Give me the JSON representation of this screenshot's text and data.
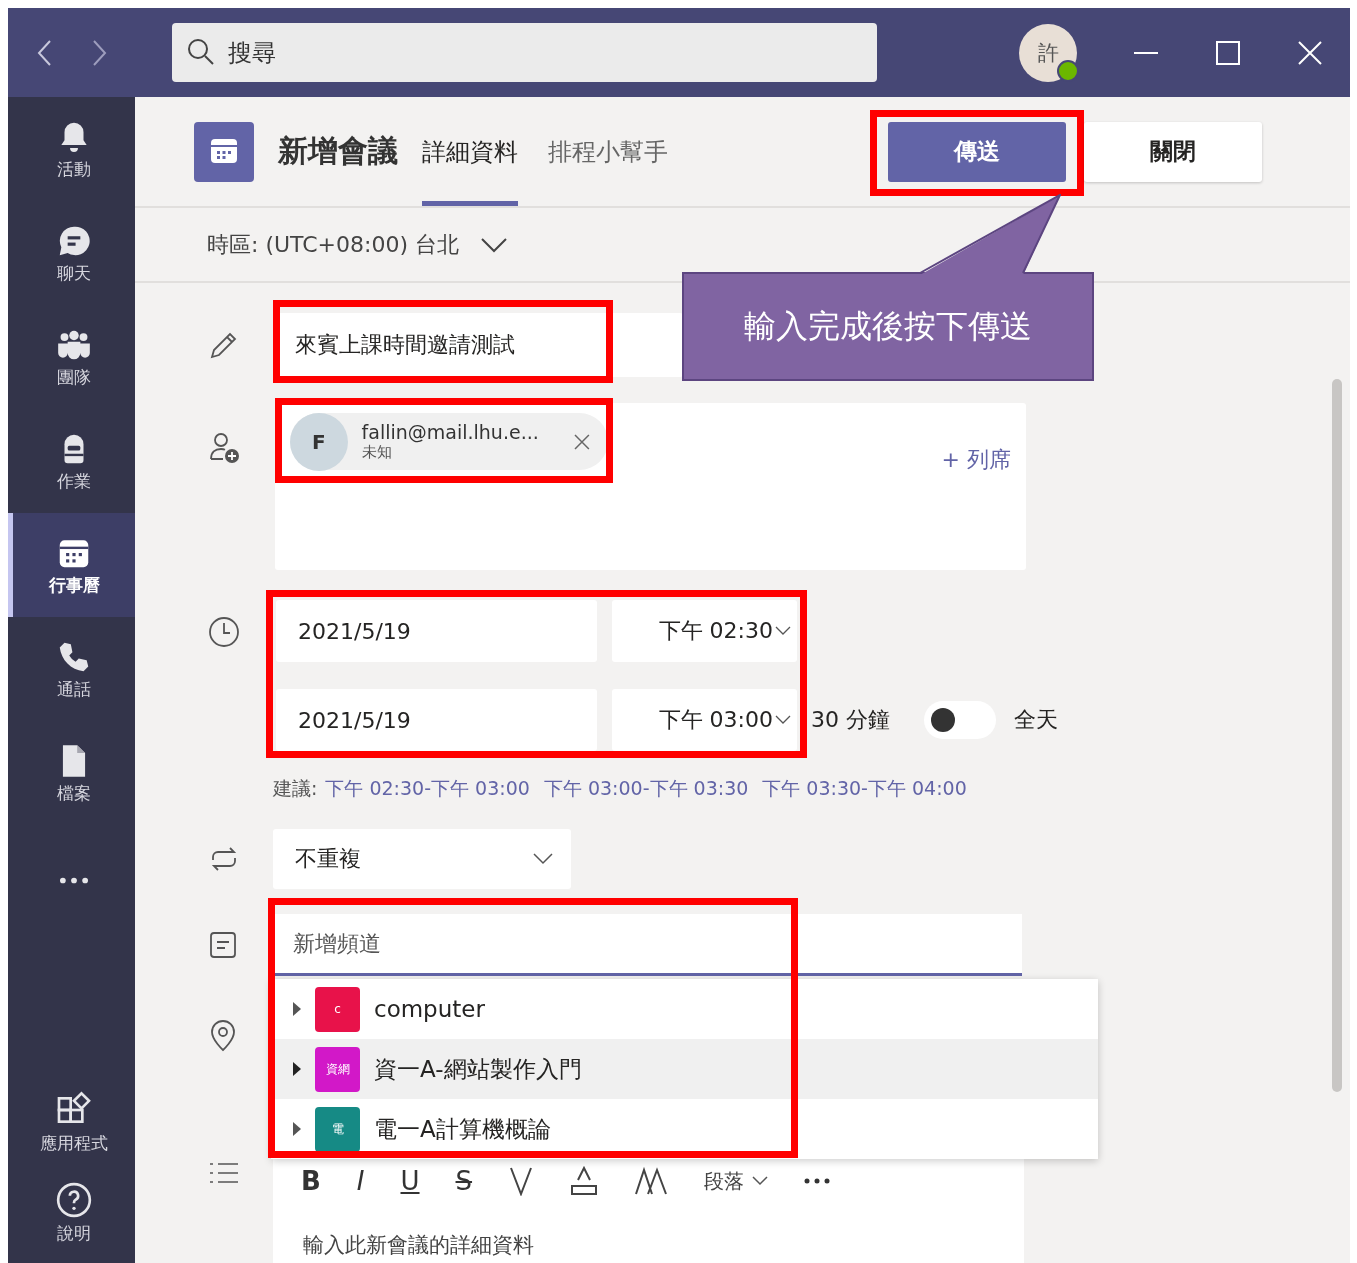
{
  "titlebar": {
    "search_placeholder": "搜尋",
    "avatar": {
      "initial": "許",
      "online": true
    }
  },
  "sidebar": [
    {
      "kind": "bell",
      "label": "活動",
      "selected": false
    },
    {
      "kind": "chat",
      "label": "聊天",
      "selected": false
    },
    {
      "kind": "teams",
      "label": "團隊",
      "selected": false
    },
    {
      "kind": "bag",
      "label": "作業",
      "selected": false
    },
    {
      "kind": "calendar",
      "label": "行事曆",
      "selected": true
    },
    {
      "kind": "phone",
      "label": "通話",
      "selected": false
    },
    {
      "kind": "file",
      "label": "檔案",
      "selected": false
    },
    {
      "kind": "more",
      "selected": false
    }
  ],
  "sidebar_bottom": [
    {
      "kind": "apps",
      "label": "應用程式",
      "selected": false
    },
    {
      "kind": "help",
      "label": "說明",
      "selected": false
    }
  ],
  "header": {
    "title": "新增會議",
    "tabs": [
      {
        "label": "詳細資料",
        "selected": true
      },
      {
        "label": "排程小幫手",
        "selected": false
      }
    ],
    "buttons": [
      {
        "label": "傳送",
        "kind": "primary",
        "highlighted": true
      },
      {
        "label": "關閉",
        "kind": "secondary",
        "highlighted": false
      }
    ]
  },
  "timezone": "時區: (UTC+08:00) 台北",
  "meeting_title": {
    "value": "來賓上課時間邀請測試",
    "highlighted": true
  },
  "attendees": {
    "people": [
      {
        "initial": "F",
        "email": "fallin@mail.lhu.e...",
        "status": "未知"
      }
    ],
    "add_label": "+ 列席",
    "highlighted": true
  },
  "time": {
    "start": {
      "date": "2021/5/19",
      "time": "下午 02:30"
    },
    "end": {
      "date": "2021/5/19",
      "time": "下午 03:00"
    },
    "duration": "30 分鐘",
    "all_day": {
      "label": "全天",
      "on": false
    },
    "highlighted": true
  },
  "suggestions": {
    "label": "建議:",
    "items": [
      "下午 02:30-下午 03:00",
      "下午 03:00-下午 03:30",
      "下午 03:30-下午 04:00"
    ]
  },
  "repeat": "不重複",
  "channel": {
    "placeholder": "新增頻道",
    "highlighted": true,
    "options": [
      {
        "name": "computer",
        "badge": "c",
        "color": "#e8124a",
        "selected": false
      },
      {
        "name": "資一A-網站製作入門",
        "badge": "資網",
        "color": "#d218c8",
        "selected": true
      },
      {
        "name": "電一A計算機概論",
        "badge": "電",
        "color": "#168a85",
        "selected": false
      }
    ]
  },
  "editor": {
    "format_buttons": [
      "B",
      "I",
      "U",
      "S"
    ],
    "paragraph": "段落",
    "placeholder": "輸入此新會議的詳細資料"
  },
  "callout": "輸入完成後按下傳送"
}
